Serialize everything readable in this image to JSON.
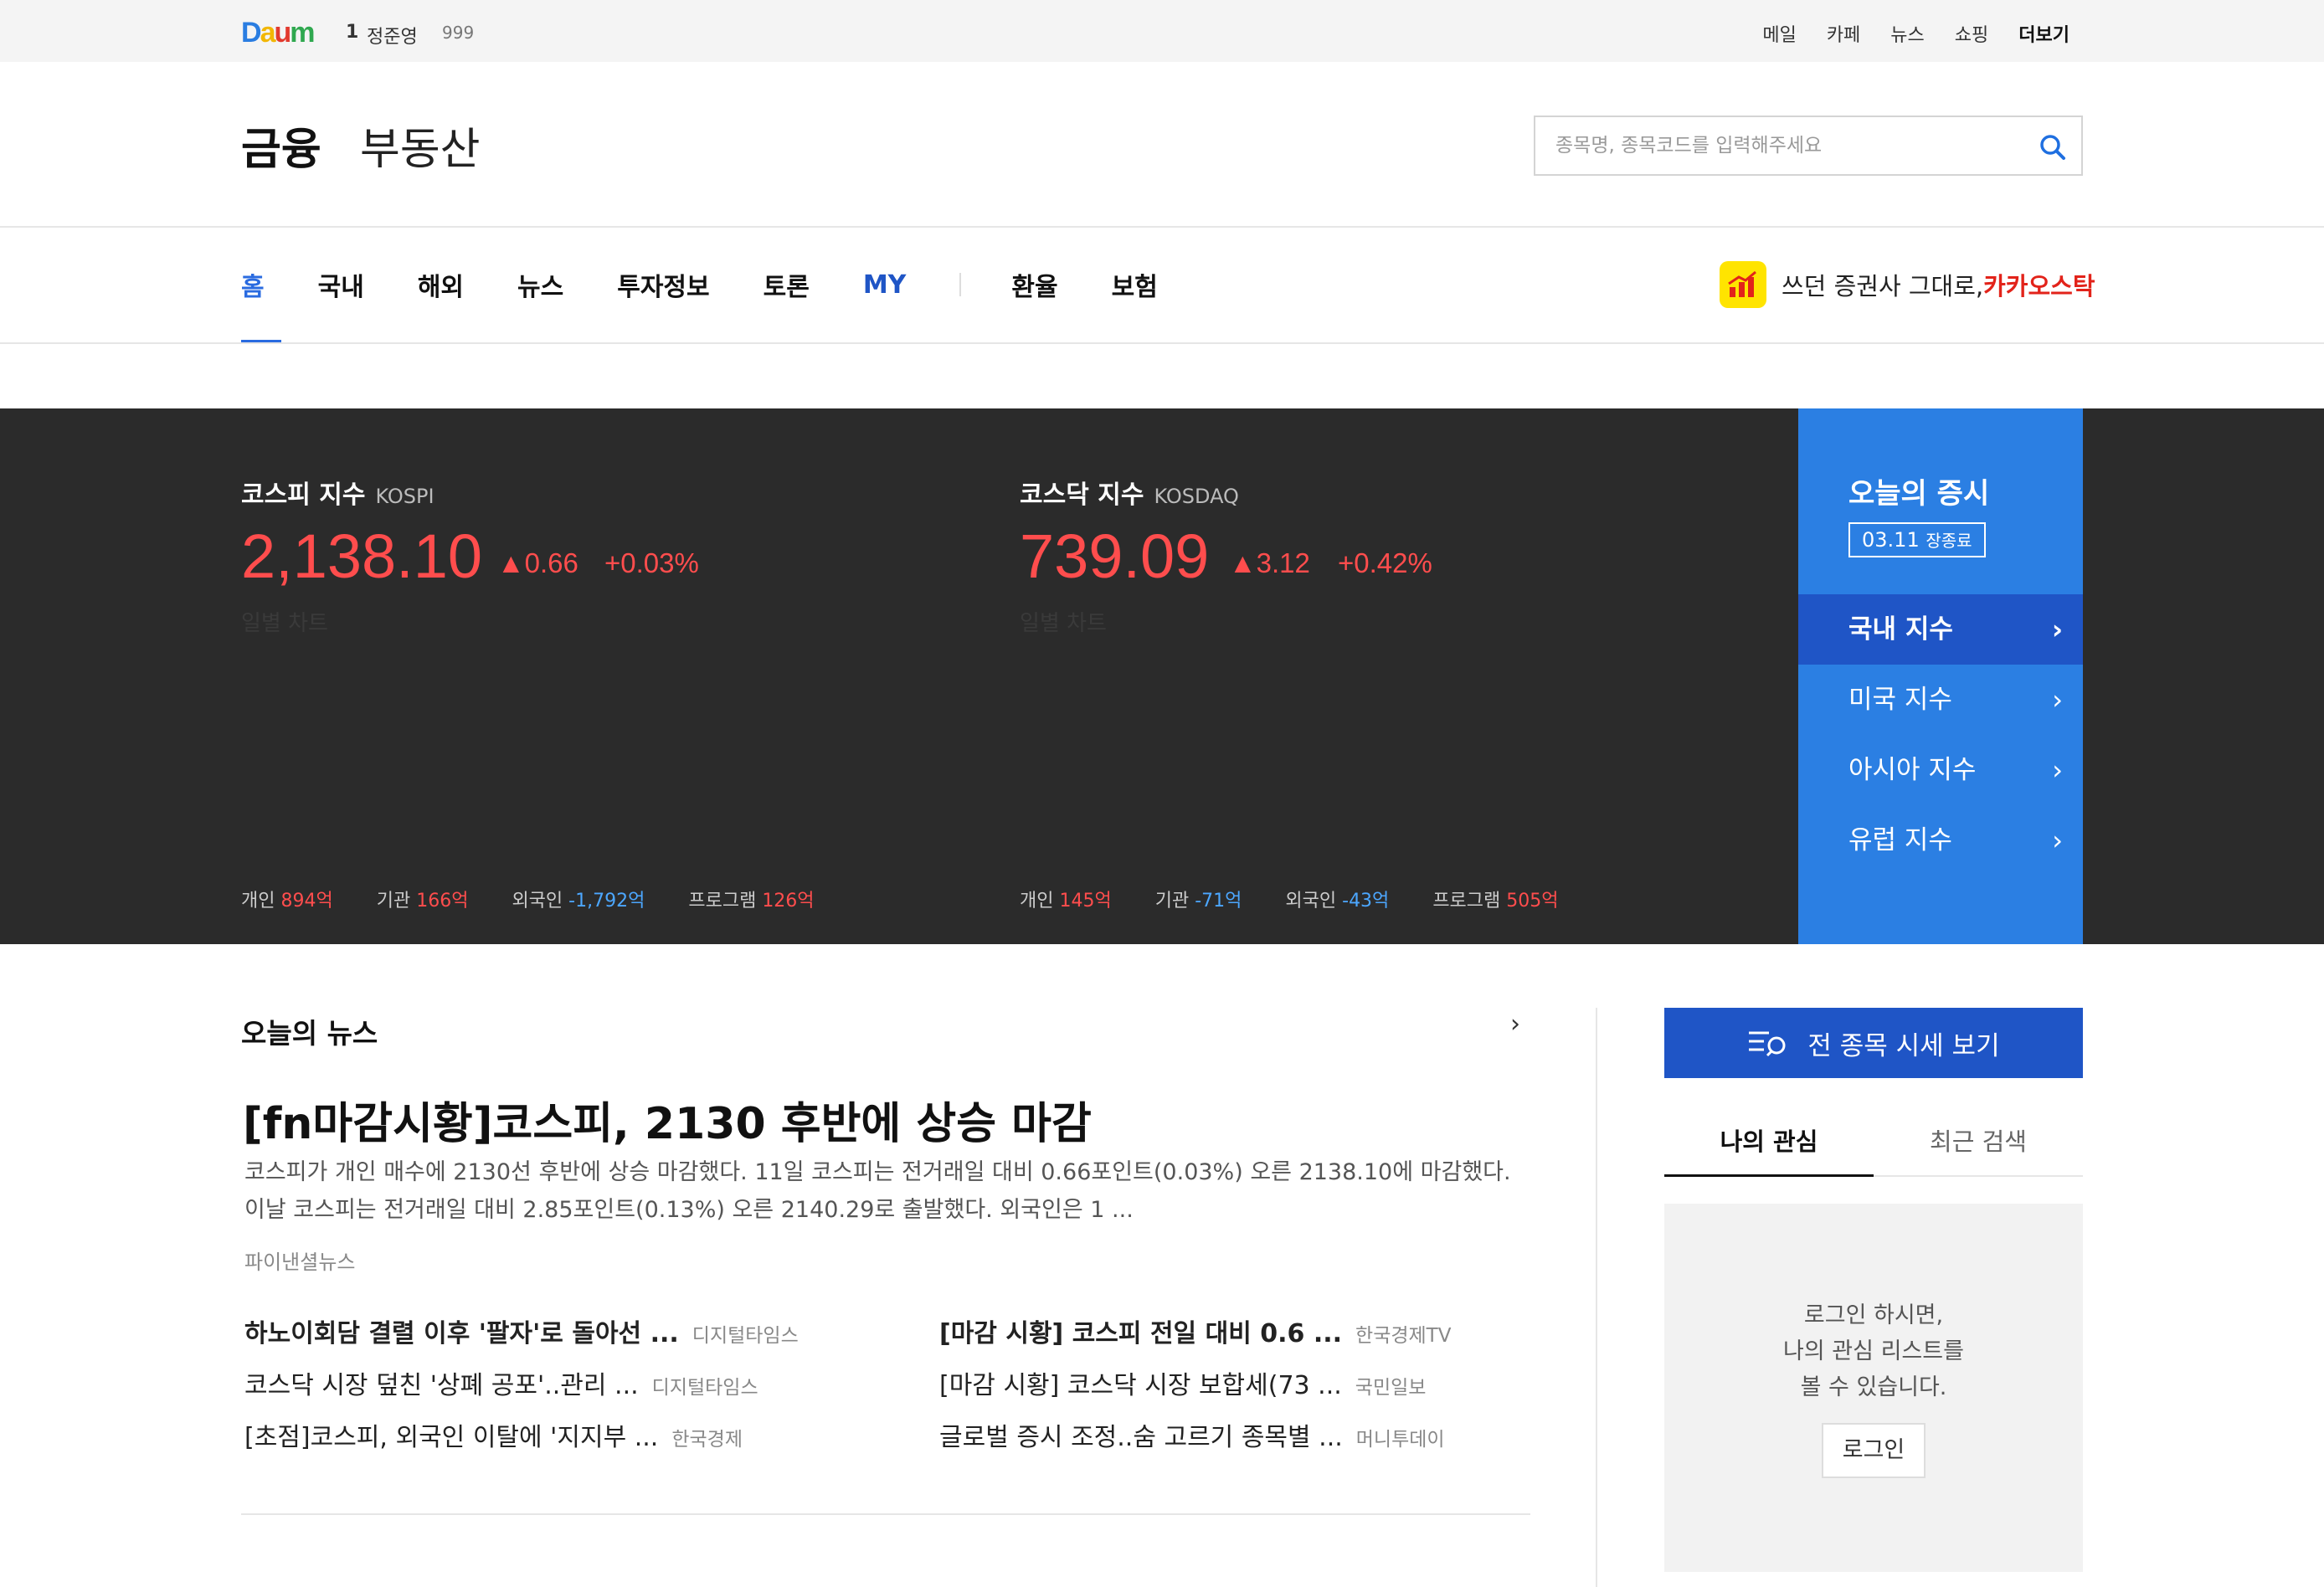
{
  "topbar": {
    "logo": "Daum",
    "rank_no": "1",
    "rank_name": "정준영",
    "rank_value": "999",
    "menu": [
      "메일",
      "카페",
      "뉴스",
      "쇼핑",
      "더보기"
    ]
  },
  "header": {
    "brand_main": "금융",
    "brand_sub": "부동산",
    "search_placeholder": "종목명, 종목코드를 입력해주세요"
  },
  "nav": {
    "items": [
      "홈",
      "국내",
      "해외",
      "뉴스",
      "투자정보",
      "토론",
      "MY"
    ],
    "items2": [
      "환율",
      "보험"
    ],
    "promo_text": "쓰던 증권사 그대로, ",
    "promo_brand": "카카오스탁"
  },
  "market": {
    "kospi": {
      "title": "코스피 지수",
      "sub": "KOSPI",
      "value": "2,138.10",
      "change": "▲0.66",
      "rate": "+0.03%",
      "chart_label": "일별 차트",
      "flow": [
        {
          "label": "개인",
          "value": "894억",
          "dir": "up"
        },
        {
          "label": "기관",
          "value": "166억",
          "dir": "up"
        },
        {
          "label": "외국인",
          "value": "-1,792억",
          "dir": "down"
        },
        {
          "label": "프로그램",
          "value": "126억",
          "dir": "up"
        }
      ]
    },
    "kosdaq": {
      "title": "코스닥 지수",
      "sub": "KOSDAQ",
      "value": "739.09",
      "change": "▲3.12",
      "rate": "+0.42%",
      "chart_label": "일별 차트",
      "flow": [
        {
          "label": "개인",
          "value": "145억",
          "dir": "up"
        },
        {
          "label": "기관",
          "value": "-71억",
          "dir": "down"
        },
        {
          "label": "외국인",
          "value": "-43억",
          "dir": "down"
        },
        {
          "label": "프로그램",
          "value": "505억",
          "dir": "up"
        }
      ]
    },
    "side": {
      "title": "오늘의 증시",
      "date": "03.11",
      "date_status": "장종료",
      "menu": [
        "국내 지수",
        "미국 지수",
        "아시아 지수",
        "유럽 지수"
      ]
    }
  },
  "news": {
    "section_title": "오늘의 뉴스",
    "headline": "[fn마감시황]코스피, 2130 후반에 상승 마감",
    "summary": "코스피가 개인 매수에 2130선 후반에 상승 마감했다. 11일 코스피는 전거래일 대비 0.66포인트(0.03%) 오른 2138.10에 마감했다. 이날 코스피는 전거래일 대비 2.85포인트(0.13%) 오른 2140.29로 출발했다. 외국인은 1 ...",
    "source": "파이낸셜뉴스",
    "left": [
      {
        "title": "하노이회담 결렬 이후 '팔자'로 돌아선 ...",
        "src": "디지털타임스",
        "bold": true
      },
      {
        "title": "코스닥 시장 덮친 '상폐 공포'..관리 ...",
        "src": "디지털타임스",
        "bold": false
      },
      {
        "title": "[초점]코스피, 외국인 이탈에 '지지부 ...",
        "src": "한국경제",
        "bold": false
      }
    ],
    "right": [
      {
        "title": "[마감 시황] 코스피 전일 대비 0.6 ...",
        "src": "한국경제TV",
        "bold": true
      },
      {
        "title": "[마감 시황] 코스닥 시장 보합세(73 ...",
        "src": "국민일보",
        "bold": false
      },
      {
        "title": "글로벌 증시 조정..숨 고르기 종목별 ...",
        "src": "머니투데이",
        "bold": false
      }
    ]
  },
  "aside": {
    "all_button": "전 종목 시세 보기",
    "tabs": [
      "나의 관심",
      "최근 검색"
    ],
    "login_msg": [
      "로그인 하시면,",
      "나의 관심 리스트를",
      "볼 수 있습니다."
    ],
    "login_button": "로그인"
  },
  "colors": {
    "up": "#ff4d4d",
    "down": "#4ca7ff",
    "accent": "#1f55c6",
    "panel": "#2b7fe3",
    "band": "#2b2b2b"
  }
}
